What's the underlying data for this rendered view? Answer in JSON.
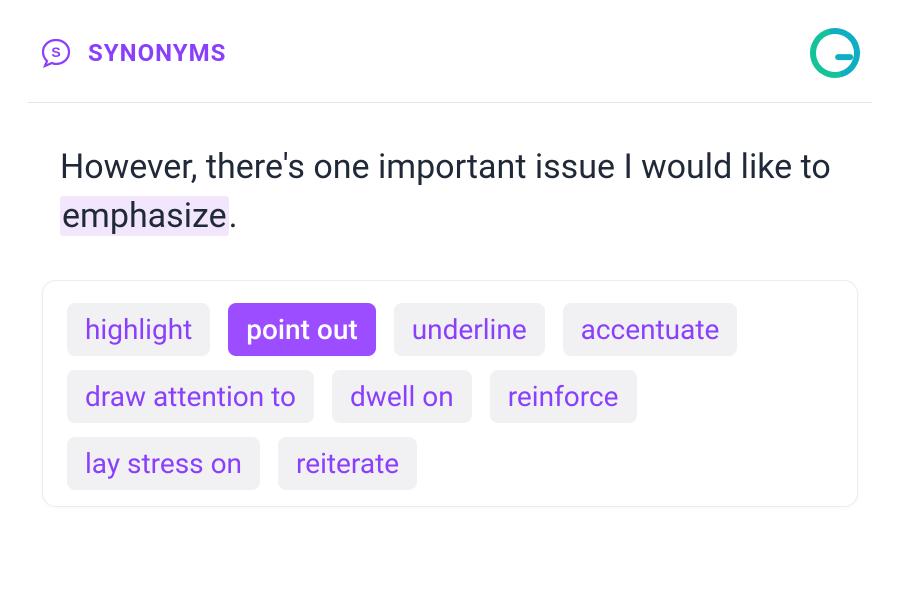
{
  "header": {
    "title": "SYNONYMS"
  },
  "sentence": {
    "before": "However, there's one important issue I would like to ",
    "highlighted": "emphasize",
    "after": "."
  },
  "synonyms": [
    {
      "label": "highlight",
      "selected": false
    },
    {
      "label": "point out",
      "selected": true
    },
    {
      "label": "underline",
      "selected": false
    },
    {
      "label": "accentuate",
      "selected": false
    },
    {
      "label": "draw attention to",
      "selected": false
    },
    {
      "label": "dwell on",
      "selected": false
    },
    {
      "label": "reinforce",
      "selected": false
    },
    {
      "label": "lay stress on",
      "selected": false
    },
    {
      "label": "reiterate",
      "selected": false
    }
  ]
}
